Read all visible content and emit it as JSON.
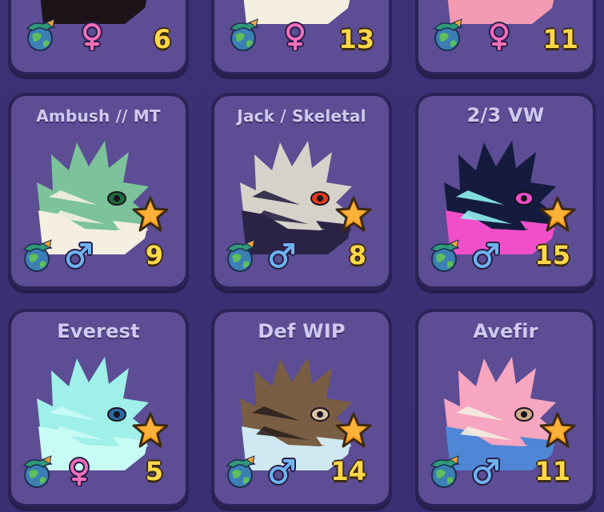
{
  "top_row": [
    {
      "level": "6",
      "gender": "female",
      "colors": {
        "main": "#f4efe0",
        "accent": "#1c1418"
      }
    },
    {
      "level": "13",
      "gender": "female",
      "colors": {
        "main": "#f39ab4",
        "accent": "#f4efe0"
      }
    },
    {
      "level": "11",
      "gender": "female",
      "colors": {
        "main": "#f4efe0",
        "accent": "#f39ab4"
      }
    }
  ],
  "cards": [
    {
      "name": "Ambush // MT",
      "level": "9",
      "gender": "male",
      "colors": {
        "main": "#7cc29a",
        "secondary": "#f4efe0",
        "eye": "#1f6b3b"
      }
    },
    {
      "name": "Jack / Skeletal",
      "level": "8",
      "gender": "male",
      "colors": {
        "main": "#d6d2c9",
        "secondary": "#2a2345",
        "eye": "#e03a1c"
      }
    },
    {
      "name": "2/3 VW",
      "level": "15",
      "gender": "male",
      "colors": {
        "main": "#141b3e",
        "secondary": "#f14fc9",
        "third": "#8ff2ef",
        "eye": "#f14fc9"
      }
    },
    {
      "name": "Everest",
      "level": "5",
      "gender": "female",
      "colors": {
        "main": "#9ff0e8",
        "secondary": "#c9fbf6",
        "eye": "#2a6aa0"
      }
    },
    {
      "name": "Def WIP",
      "level": "14",
      "gender": "male",
      "colors": {
        "main": "#7a5e43",
        "secondary": "#cfe8f2",
        "third": "#2c2220",
        "eye": "#d9c4a4"
      }
    },
    {
      "name": "Avefir",
      "level": "11",
      "gender": "male",
      "colors": {
        "main": "#f6a6c0",
        "secondary": "#4f86d6",
        "third": "#f4efe0",
        "eye": "#cfa987"
      }
    }
  ],
  "icons": {
    "element": "earth-dragon-icon",
    "favorite": "star-icon"
  }
}
